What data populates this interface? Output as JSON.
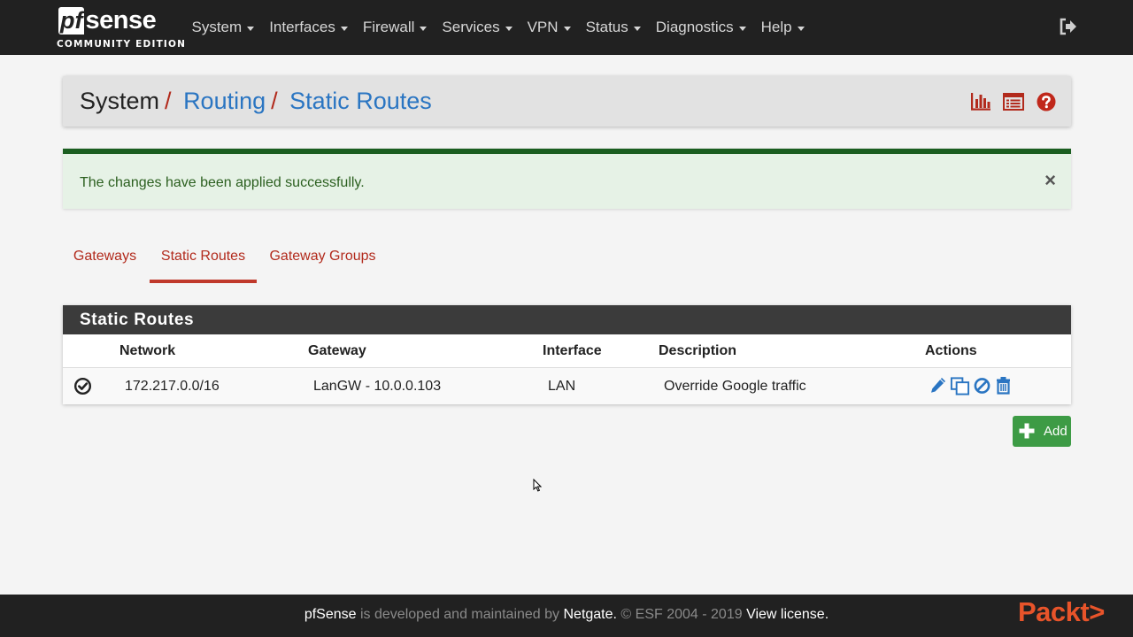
{
  "brand": {
    "logo_pf": "pf",
    "logo_sense": "sense",
    "edition": "COMMUNITY EDITION"
  },
  "nav": {
    "items": [
      {
        "label": "System"
      },
      {
        "label": "Interfaces"
      },
      {
        "label": "Firewall"
      },
      {
        "label": "Services"
      },
      {
        "label": "VPN"
      },
      {
        "label": "Status"
      },
      {
        "label": "Diagnostics"
      },
      {
        "label": "Help"
      }
    ],
    "logout_icon": "sign-out-icon"
  },
  "breadcrumb": {
    "root": "System",
    "sep": "/",
    "level2": "Routing",
    "level3": "Static Routes",
    "icons": [
      "bar-chart-icon",
      "list-icon",
      "question-circle-icon"
    ]
  },
  "alert": {
    "message": "The changes have been applied successfully.",
    "close": "×"
  },
  "tabs": [
    {
      "label": "Gateways",
      "active": false
    },
    {
      "label": "Static Routes",
      "active": true
    },
    {
      "label": "Gateway Groups",
      "active": false
    }
  ],
  "routes_panel": {
    "title": "Static Routes",
    "columns": [
      "Network",
      "Gateway",
      "Interface",
      "Description",
      "Actions"
    ],
    "rows": [
      {
        "status_icon": "check-circle-icon",
        "network": "172.217.0.0/16",
        "gateway": "LanGW - 10.0.0.103",
        "interface": "LAN",
        "description": "Override Google traffic",
        "actions": [
          "pencil-icon",
          "clone-icon",
          "ban-icon",
          "trash-icon"
        ]
      }
    ]
  },
  "add_button": {
    "label": "Add",
    "icon": "plus-icon"
  },
  "footer": {
    "brand": "pfSense",
    "developed": " is developed and maintained by ",
    "company": "Netgate.",
    "copyright": " © ESF 2004 - 2019 ",
    "license": "View license."
  },
  "watermark": "Packt>",
  "colors": {
    "navbar": "#212121",
    "accent_red": "#b22a1c",
    "link_blue": "#2a75c2",
    "success_green": "#1b5e20",
    "add_green": "#3d9b45",
    "icon_blue": "#2a75c2"
  }
}
